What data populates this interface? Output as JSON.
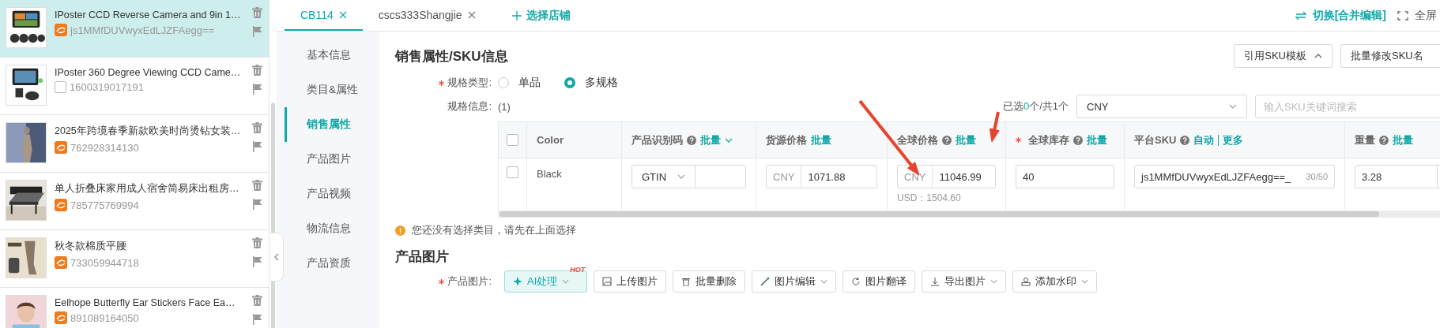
{
  "product_list": [
    {
      "title": "IPoster CCD Reverse Camera and 9in 1…",
      "id": "js1MMfDUVwyxEdLJZFAegg==",
      "kind": "swirl",
      "selected": true
    },
    {
      "title": "IPoster 360 Degree Viewing CCD Came…",
      "id": "1600319017191",
      "kind": "checkbox",
      "selected": false
    },
    {
      "title": "2025年跨境春季新款欧美时尚烫钻女装…",
      "id": "762928314130",
      "kind": "swirl",
      "selected": false
    },
    {
      "title": "单人折叠床家用成人宿舍简易床出租房…",
      "id": "785775769994",
      "kind": "swirl",
      "selected": false
    },
    {
      "title": "秋冬款棉质平腰",
      "id": "733059944718",
      "kind": "swirl",
      "selected": false
    },
    {
      "title": "Eelhope Butterfly Ear Stickers Face Ea…",
      "id": "891089164050",
      "kind": "swirl",
      "selected": false
    }
  ],
  "tabs": [
    {
      "label": "CB114",
      "selected": true
    },
    {
      "label": "cscs333Shangjie",
      "selected": false
    }
  ],
  "add_store": "选择店铺",
  "top_actions": [
    {
      "kind": "switch",
      "label": "切换[合并编辑]"
    },
    {
      "kind": "fullscreen",
      "label": "全屏"
    }
  ],
  "nav": [
    {
      "label": "基本信息",
      "selected": false
    },
    {
      "label": "类目&属性",
      "selected": false
    },
    {
      "label": "销售属性",
      "selected": true
    },
    {
      "label": "产品图片",
      "selected": false
    },
    {
      "label": "产品视频",
      "selected": false
    },
    {
      "label": "物流信息",
      "selected": false
    },
    {
      "label": "产品资质",
      "selected": false
    }
  ],
  "section_title": "销售属性/SKU信息",
  "section_buttons": [
    {
      "label": "引用SKU模板",
      "caret": true
    },
    {
      "label": "批量修改SKU名",
      "caret": false
    }
  ],
  "spec_type": {
    "label": "规格类型:",
    "required": true,
    "options": [
      {
        "label": "单品",
        "selected": false
      },
      {
        "label": "多规格",
        "selected": true
      }
    ]
  },
  "spec_info": {
    "label": "规格信息:",
    "value": "(1)"
  },
  "selection": {
    "prefix": "已选",
    "count": "0",
    "suffix": "个/共1个"
  },
  "currency": "CNY",
  "sku_search": {
    "placeholder": "输入SKU关键词搜索"
  },
  "table": {
    "header_checked": false,
    "columns": [
      {
        "kind": "check"
      },
      {
        "label": "Color"
      },
      {
        "label": "产品识别码",
        "help": true,
        "actions": [
          "批量"
        ],
        "caret": true
      },
      {
        "label": "货源价格",
        "actions": [
          "批量"
        ]
      },
      {
        "label": "全球价格",
        "help": true,
        "actions": [
          "批量"
        ]
      },
      {
        "label": "全球库存",
        "required": true,
        "help": true,
        "actions": [
          "批量"
        ]
      },
      {
        "label": "平台SKU",
        "help": true,
        "actions": [
          "自动",
          "更多"
        ]
      },
      {
        "label": "重量",
        "help": true,
        "actions": [
          "批量"
        ]
      }
    ],
    "rows": [
      {
        "cells": [
          {
            "kind": "checkbox",
            "checked": false
          },
          {
            "kind": "text",
            "value": "Black"
          },
          {
            "kind": "id_select",
            "value": "GTIN"
          },
          {
            "kind": "price",
            "prefix": "CNY",
            "value": "1071.88"
          },
          {
            "kind": "price",
            "prefix": "CNY",
            "value": "11046.99",
            "note": "USD：1504.60"
          },
          {
            "kind": "input",
            "value": "40"
          },
          {
            "kind": "sku",
            "value": "js1MMfDUVwyxEdLJZFAegg==_",
            "counter": "30/50"
          },
          {
            "kind": "weight",
            "value": "3.28"
          }
        ]
      }
    ]
  },
  "warning": "您还没有选择类目，请先在上面选择",
  "images_section": {
    "title": "产品图片",
    "label": "产品图片:",
    "required": true,
    "buttons": [
      {
        "kind": "ai",
        "label": "AI处理",
        "badge": "HOT",
        "caret": true
      },
      {
        "kind": "upload",
        "label": "上传图片"
      },
      {
        "kind": "delete",
        "label": "批量删除"
      },
      {
        "kind": "edit",
        "label": "图片编辑",
        "caret": true
      },
      {
        "kind": "translate",
        "label": "图片翻译"
      },
      {
        "kind": "export",
        "label": "导出图片",
        "caret": true
      },
      {
        "kind": "watermark",
        "label": "添加水印",
        "caret": true
      }
    ]
  },
  "annotations": [
    {
      "kind": "arrow",
      "color": "#e8432c"
    },
    {
      "kind": "arrow",
      "color": "#e8432c"
    }
  ]
}
